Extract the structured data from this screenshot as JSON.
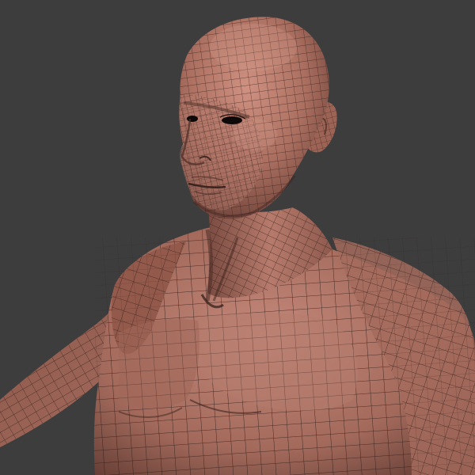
{
  "scene": {
    "background_color": "#3d3d3d",
    "subject": "3d-human-bust-wireframe-model",
    "skin_color": "#b07566",
    "skin_shadow_color": "#6e443b",
    "skin_highlight_color": "#cc8f80",
    "wire_color": "#2a1a16",
    "eye_color": "#0d0908"
  }
}
